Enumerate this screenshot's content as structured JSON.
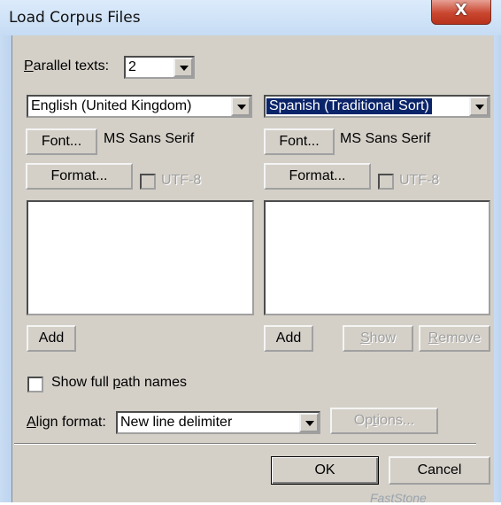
{
  "window": {
    "title": "Load Corpus Files",
    "close_glyph": "X"
  },
  "parallel": {
    "label_accel": "P",
    "label_rest": "arallel texts:",
    "value": "2"
  },
  "left": {
    "language": "English (United Kingdom)",
    "font_button": "Font...",
    "font_name": "MS Sans Serif",
    "format_button": "Format...",
    "utf8_label": "UTF-8",
    "add_button": "Add"
  },
  "right": {
    "language": "Spanish (Traditional Sort)",
    "font_button": "Font...",
    "font_name": "MS Sans Serif",
    "format_button": "Format...",
    "utf8_label": "UTF-8",
    "add_button": "Add",
    "show_accel": "S",
    "show_rest": "how",
    "remove_accel": "R",
    "remove_rest": "emove"
  },
  "show_path": {
    "pre": "Show full ",
    "accel": "p",
    "post": "ath names"
  },
  "align": {
    "label_accel": "A",
    "label_rest": "lign format:",
    "value": "New line delimiter",
    "options_pre": "Op",
    "options_accel": "t",
    "options_post": "ions..."
  },
  "footer": {
    "ok": "OK",
    "cancel": "Cancel"
  },
  "watermark": "FastStone"
}
